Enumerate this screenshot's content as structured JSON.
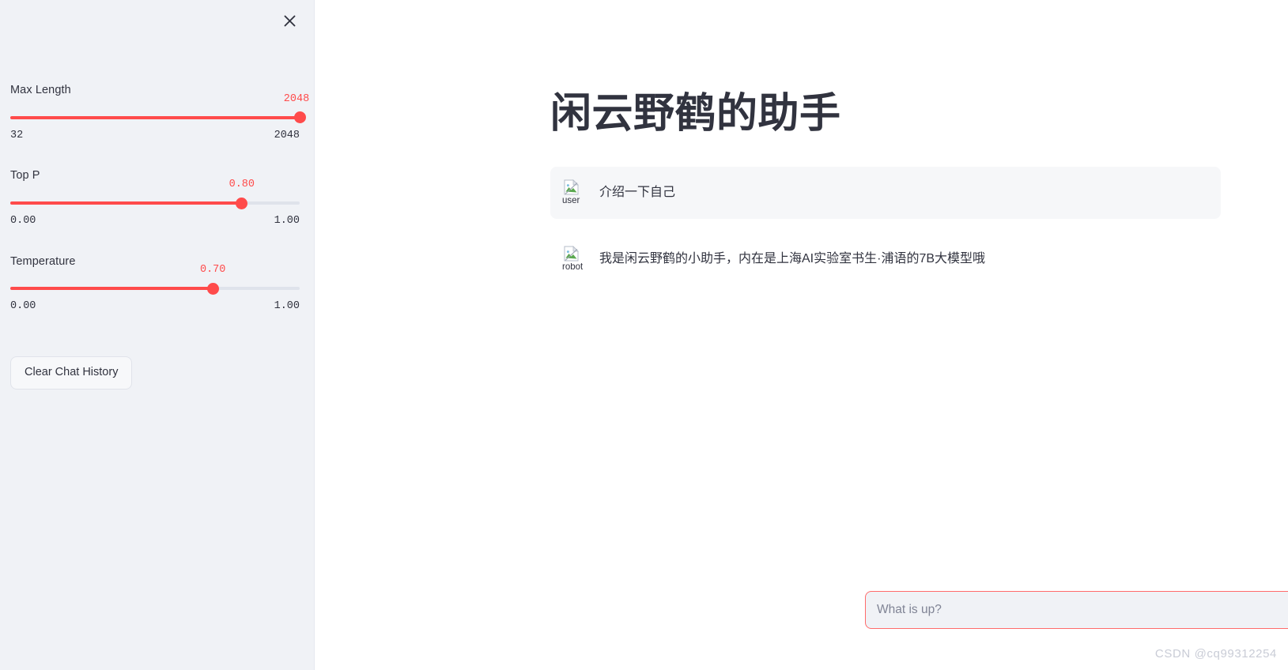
{
  "sidebar": {
    "close_icon": "close-icon",
    "sliders": [
      {
        "label": "Max Length",
        "value_display": "2048",
        "min_display": "32",
        "max_display": "2048",
        "percent": 100
      },
      {
        "label": "Top P",
        "value_display": "0.80",
        "min_display": "0.00",
        "max_display": "1.00",
        "percent": 80
      },
      {
        "label": "Temperature",
        "value_display": "0.70",
        "min_display": "0.00",
        "max_display": "1.00",
        "percent": 70
      }
    ],
    "clear_button_label": "Clear Chat History"
  },
  "main": {
    "title": "闲云野鹤的助手",
    "messages": [
      {
        "role": "user",
        "avatar_alt": "user",
        "avatar_icon": "broken-image-icon",
        "text": "介绍一下自己"
      },
      {
        "role": "assistant",
        "avatar_alt": "robot",
        "avatar_icon": "broken-image-icon",
        "text": "我是闲云野鹤的小助手，内在是上海AI实验室书生·浦语的7B大模型哦"
      }
    ],
    "input": {
      "value": "",
      "placeholder": "What is up?",
      "send_icon": "send-icon"
    }
  },
  "watermark": "CSDN @cq99312254",
  "colors": {
    "accent": "#ff4b4b",
    "sidebar_bg": "#f0f2f6",
    "text": "#31333f",
    "track_inactive": "#dfe3eb",
    "input_border": "#ff6b6b",
    "send_icon": "#9aa0b0"
  }
}
